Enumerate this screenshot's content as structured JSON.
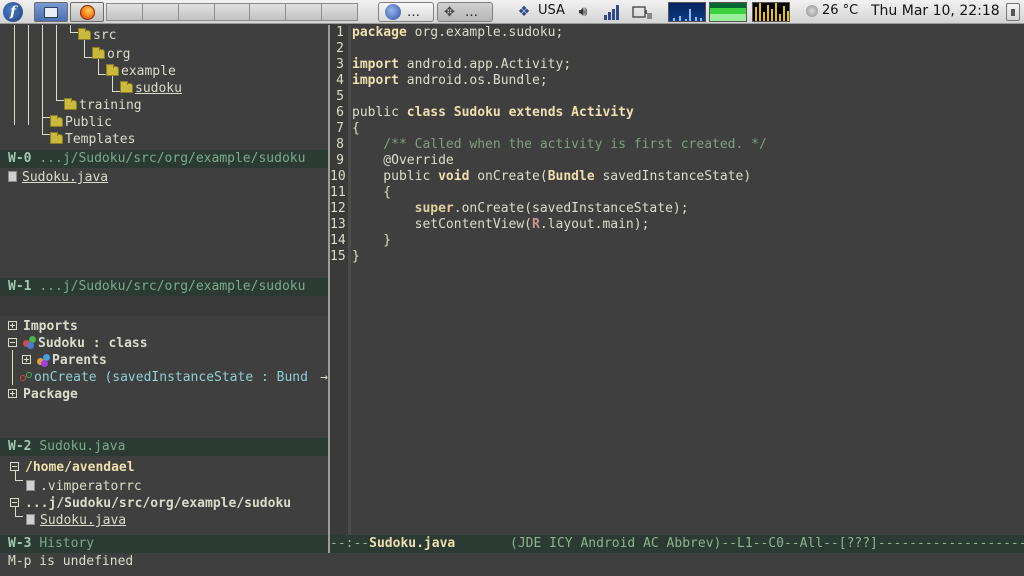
{
  "panel": {
    "fedora_letter": "f",
    "tasks": [
      {
        "label": "…"
      },
      {
        "label": "…"
      }
    ],
    "keyboard_layout": "USA",
    "temperature": "26 °C",
    "clock": "Thu Mar 10, 22:18"
  },
  "dirtree": {
    "items": [
      {
        "label": "src",
        "depth": 5
      },
      {
        "label": "org",
        "depth": 6
      },
      {
        "label": "example",
        "depth": 7
      },
      {
        "label": "sudoku",
        "depth": 8
      },
      {
        "label": "training",
        "depth": 4
      },
      {
        "label": "Public",
        "depth": 3
      },
      {
        "label": "Templates",
        "depth": 3
      }
    ]
  },
  "windows": {
    "w0": {
      "id": "W-0",
      "path": "...j/Sudoku/src/org/example/sudoku"
    },
    "w1": {
      "id": "W-1",
      "path": "...j/Sudoku/src/org/example/sudoku"
    },
    "w2": {
      "id": "W-2",
      "path": "Sudoku.java"
    },
    "w3": {
      "id": "W-3",
      "path": "History"
    }
  },
  "filelist": {
    "files": [
      "Sudoku.java"
    ]
  },
  "outline": {
    "imports": "Imports",
    "class_name": "Sudoku",
    "class_kind": ": class",
    "parents": "Parents",
    "method": "onCreate",
    "method_args": "(savedInstanceState : Bund",
    "package": "Package",
    "more_arrow": "→"
  },
  "history": {
    "root": "/home/avendael",
    "root_child": ".vimperatorrc",
    "dir": "...j/Sudoku/src/org/example/sudoku",
    "dir_child": "Sudoku.java"
  },
  "editor": {
    "lines": [
      {
        "n": "1"
      },
      {
        "n": "2"
      },
      {
        "n": "3"
      },
      {
        "n": "4"
      },
      {
        "n": "5"
      },
      {
        "n": "6"
      },
      {
        "n": "7"
      },
      {
        "n": "8"
      },
      {
        "n": "9"
      },
      {
        "n": "10"
      },
      {
        "n": "11"
      },
      {
        "n": "12"
      },
      {
        "n": "13"
      },
      {
        "n": "14"
      },
      {
        "n": "15"
      }
    ],
    "tokens": {
      "l1a": "package",
      "l1b": " org.example.sudoku;",
      "l3a": "import",
      "l3b": " android.app.Activity;",
      "l4a": "import",
      "l4b": " android.os.Bundle;",
      "l6a": "public ",
      "l6b": "class",
      "l6c": " Sudoku ",
      "l6d": "extends",
      "l6e": " Activity",
      "l7": "{",
      "l8": "    /** Called when the activity is first created. */",
      "l9": "    @Override",
      "l10a": "    public ",
      "l10b": "void",
      "l10c": " onCreate(",
      "l10d": "Bundle",
      "l10e": " savedInstanceState)",
      "l11": "    {",
      "l12a": "        ",
      "l12b": "super",
      "l12c": ".onCreate(savedInstanceState);",
      "l13a": "        setContentView(",
      "l13b": "R",
      "l13c": ".layout.main);",
      "l14": "    }",
      "l15": "}"
    }
  },
  "modeline": {
    "prefix": "--:--",
    "buffer": "Sudoku.java",
    "modes": "       (JDE ICY Android AC Abbrev)--L1--C0--All--[???]-----------------------------------"
  },
  "minibuffer": {
    "message": "M-p is undefined"
  }
}
